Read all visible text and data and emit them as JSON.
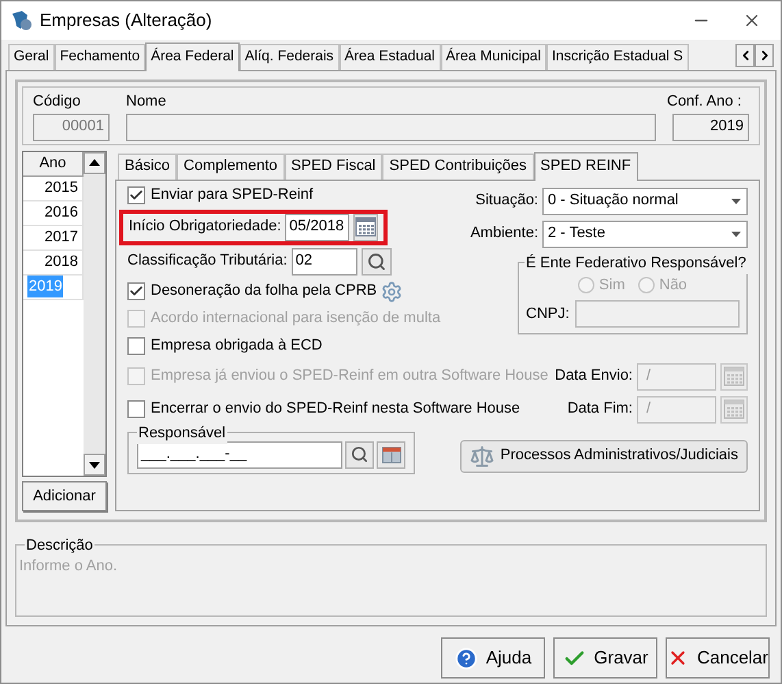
{
  "window": {
    "title": "Empresas (Alteração)"
  },
  "tabs": [
    {
      "label": "Geral",
      "selected": false
    },
    {
      "label": "Fechamento",
      "selected": false
    },
    {
      "label": "Área Federal",
      "selected": true
    },
    {
      "label": "Alíq. Federais",
      "selected": false
    },
    {
      "label": "Área Estadual",
      "selected": false
    },
    {
      "label": "Área Municipal",
      "selected": false
    },
    {
      "label": "Inscrição Estadual S",
      "selected": false
    }
  ],
  "header": {
    "codigo": {
      "label": "Código",
      "value": "00001",
      "disabled": true
    },
    "nome": {
      "label": "Nome"
    },
    "conf_ano": {
      "label": "Conf. Ano :",
      "value": "2019"
    }
  },
  "years": {
    "column": "Ano",
    "rows": [
      {
        "value": "2015",
        "selected": false
      },
      {
        "value": "2016",
        "selected": false
      },
      {
        "value": "2017",
        "selected": false
      },
      {
        "value": "2018",
        "selected": false
      },
      {
        "value": "2019",
        "selected": true
      }
    ],
    "add_button": "Adicionar"
  },
  "subtabs": [
    {
      "label": "Básico",
      "selected": false
    },
    {
      "label": "Complemento",
      "selected": false
    },
    {
      "label": "SPED Fiscal",
      "selected": false
    },
    {
      "label": "SPED Contribuições",
      "selected": false
    },
    {
      "label": "SPED REINF",
      "selected": true
    }
  ],
  "reinf": {
    "options": [
      {
        "kind": "checkbox",
        "label": "Enviar para SPED-Reinf",
        "checked": true,
        "disabled": false
      },
      {
        "kind": "date",
        "label": "Início Obrigatoriedade:",
        "value": "05/2018",
        "highlighted": true
      },
      {
        "kind": "lookup",
        "label": "Classificação Tributária:",
        "value": "02"
      },
      {
        "kind": "checkbox_settings",
        "label": "Desoneração da folha pela CPRB",
        "checked": true,
        "disabled": false
      },
      {
        "kind": "checkbox",
        "label": "Acordo internacional para isenção de multa",
        "checked": false,
        "disabled": true
      },
      {
        "kind": "checkbox",
        "label": "Empresa obrigada à ECD",
        "checked": false,
        "disabled": false
      }
    ],
    "selects": [
      {
        "label": "Situação:",
        "value": "0 - Situação normal"
      },
      {
        "label": "Ambiente:",
        "value": "2 - Teste"
      }
    ],
    "ente": {
      "title": "É Ente Federativo Responsável?",
      "radios": [
        {
          "label": "Sim",
          "selected": false,
          "disabled": true
        },
        {
          "label": "Não",
          "selected": false,
          "disabled": true
        }
      ],
      "cnpj": {
        "label": "CNPJ:",
        "disabled": true
      }
    },
    "send_rows": [
      {
        "check": {
          "label": "Empresa já enviou o SPED-Reinf em outra Software House",
          "checked": false,
          "disabled": true
        },
        "date": {
          "label": "Data Envio:",
          "value": "/",
          "disabled": true
        }
      },
      {
        "check": {
          "label": "Encerrar o envio do SPED-Reinf nesta Software House",
          "checked": false,
          "disabled": false
        },
        "date": {
          "label": "Data Fim:",
          "value": "/",
          "disabled": true
        }
      }
    ],
    "responsavel": {
      "title": "Responsável",
      "value": "___.___.___-__"
    },
    "processos_button": "Processos Administrativos/Judiciais"
  },
  "descricao": {
    "title": "Descrição",
    "text": "Informe o Ano."
  },
  "buttons": [
    {
      "kind": "help",
      "label": "Ajuda"
    },
    {
      "kind": "save",
      "label": "Gravar"
    },
    {
      "kind": "cancel",
      "label": "Cancelar"
    }
  ]
}
